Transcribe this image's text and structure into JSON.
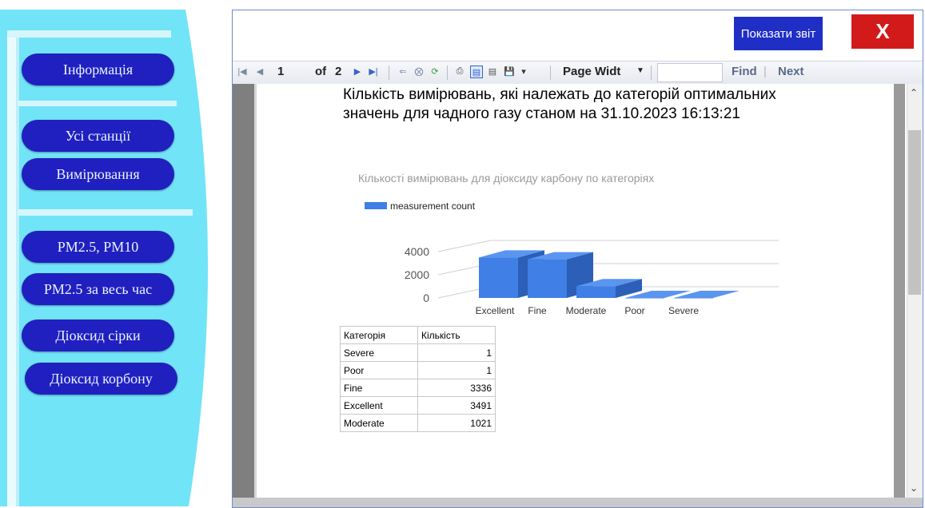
{
  "sidebar": {
    "items": [
      {
        "label": "Інформація"
      },
      {
        "label": "Усі станції"
      },
      {
        "label": "Вимірювання"
      },
      {
        "label": "PM2.5, PM10"
      },
      {
        "label": "PM2.5 за весь час"
      },
      {
        "label": "Діоксид сірки"
      },
      {
        "label": "Діоксид корбону"
      }
    ]
  },
  "report_header": {
    "show_report_label": "Показати звіт",
    "close_label": "X"
  },
  "toolbar": {
    "page_current": "1",
    "page_of": "of",
    "page_total": "2",
    "zoom": "Page Widt",
    "find_label": "Find",
    "separator": "|",
    "next_label": "Next"
  },
  "report": {
    "title_line1": "Кількість вимірювань, які належать до категорій оптимальних",
    "title_line2": "значень для чадного газу станом на 31.10.2023 16:13:21"
  },
  "chart_data": {
    "type": "bar",
    "title": "Кількості вимірювань для діоксиду карбону по категоріях",
    "categories": [
      "Excellent",
      "Fine",
      "Moderate",
      "Poor",
      "Severe"
    ],
    "series": [
      {
        "name": "measurement count",
        "values": [
          3491,
          3336,
          1021,
          1,
          1
        ]
      }
    ],
    "yticks": [
      "4000",
      "2000",
      "0"
    ],
    "ylim": [
      0,
      4000
    ],
    "style": "3d",
    "legend_position": "top-left",
    "grid": true,
    "color": "#3f7fe6"
  },
  "table": {
    "headers": [
      "Категорія",
      "Кількість"
    ],
    "rows": [
      [
        "Severe",
        "1"
      ],
      [
        "Poor",
        "1"
      ],
      [
        "Fine",
        "3336"
      ],
      [
        "Excellent",
        "3491"
      ],
      [
        "Moderate",
        "1021"
      ]
    ]
  },
  "colors": {
    "sidebar_bg": "#72e4f7",
    "nav_button": "#2020c0",
    "show_button": "#1f2ec4",
    "close_button": "#d21a1a"
  }
}
